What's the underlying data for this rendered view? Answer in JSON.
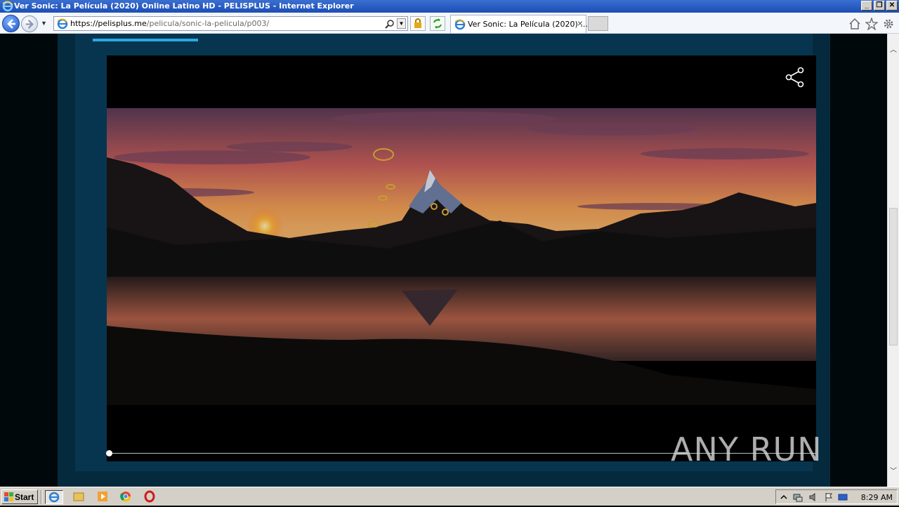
{
  "window": {
    "title": "Ver Sonic: La Película (2020) Online Latino HD - PELISPLUS - Internet Explorer",
    "buttons": [
      "minimize",
      "restore",
      "close"
    ]
  },
  "navbar": {
    "url_host": "https://pelisplus.me",
    "url_path": "/pelicula/sonic-la-pelicula/p003/",
    "tab_label": "Ver Sonic: La Película (2020) ...",
    "icons": [
      "back-icon",
      "forward-icon",
      "search-icon",
      "lock-icon",
      "refresh-icon",
      "home-icon",
      "favorites-star-icon",
      "settings-gear-icon"
    ]
  },
  "player": {
    "share_icon": "share-icon",
    "progress": 0.0,
    "watermark": "ANY RUN"
  },
  "taskbar": {
    "start_label": "Start",
    "quick_launch": [
      "internet-explorer-icon",
      "file-explorer-icon",
      "media-player-icon",
      "chrome-icon",
      "opera-icon"
    ],
    "tray_icons": [
      "show-hidden-icon",
      "network-icon",
      "volume-icon",
      "action-center-flag-icon",
      "display-icon"
    ],
    "clock": "8:29 AM"
  },
  "colors": {
    "page_bg": "#052a3e",
    "page_inner": "#073550",
    "accent": "#2aa9e0",
    "titlebar": "#1c4db5"
  }
}
